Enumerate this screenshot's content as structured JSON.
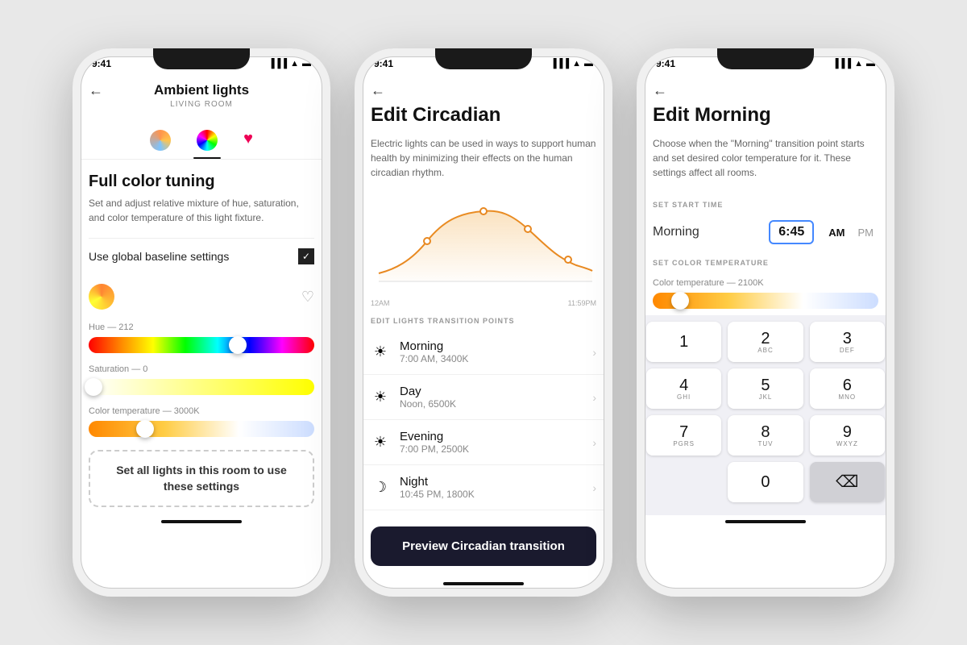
{
  "phone1": {
    "status_time": "9:41",
    "title": "Ambient lights",
    "subtitle": "LIVING ROOM",
    "tabs": [
      {
        "label": "circadian",
        "icon": "circadian"
      },
      {
        "label": "color",
        "icon": "color",
        "active": true
      },
      {
        "label": "favorite",
        "icon": "heart"
      }
    ],
    "section_title": "Full color tuning",
    "section_desc": "Set and adjust relative mixture of hue, saturation, and color temperature of this light fixture.",
    "global_baseline_label": "Use global baseline settings",
    "hue_label": "Hue — 212",
    "hue_thumb_pos": "66%",
    "saturation_label": "Saturation — 0",
    "saturation_thumb_pos": "2%",
    "color_temp_label": "Color temperature — 3000K",
    "color_temp_thumb_pos": "25%",
    "set_all_btn": "Set all lights in this room to use these settings"
  },
  "phone2": {
    "status_time": "9:41",
    "title": "Edit Circadian",
    "description": "Electric lights can be used in ways to support human health by minimizing their effects on the human circadian rhythm.",
    "chart_label_start": "12AM",
    "chart_label_end": "11:59PM",
    "edit_label": "EDIT LIGHTS TRANSITION POINTS",
    "transitions": [
      {
        "icon": "☀",
        "name": "Morning",
        "detail": "7:00 AM, 3400K"
      },
      {
        "icon": "☀",
        "name": "Day",
        "detail": "Noon, 6500K"
      },
      {
        "icon": "☀",
        "name": "Evening",
        "detail": "7:00 PM, 2500K"
      },
      {
        "icon": "☽",
        "name": "Night",
        "detail": "10:45 PM, 1800K"
      }
    ],
    "preview_btn": "Preview Circadian transition"
  },
  "phone3": {
    "status_time": "9:41",
    "title": "Edit Morning",
    "description": "Choose when the \"Morning\" transition point starts and set desired color temperature for it. These settings affect all rooms.",
    "set_start_label": "SET START TIME",
    "time_label": "Morning",
    "time_value": "6:45",
    "am_label": "AM",
    "pm_label": "PM",
    "set_color_label": "SET COLOR TEMPERATURE",
    "color_temp_value": "Color temperature — 2100K",
    "color_temp_thumb_pos": "12%",
    "numpad": {
      "keys": [
        [
          {
            "num": "1",
            "letters": ""
          },
          {
            "num": "2",
            "letters": "ABC"
          },
          {
            "num": "3",
            "letters": "DEF"
          }
        ],
        [
          {
            "num": "4",
            "letters": "GHI"
          },
          {
            "num": "5",
            "letters": "JKL"
          },
          {
            "num": "6",
            "letters": "MNO"
          }
        ],
        [
          {
            "num": "7",
            "letters": "PGRS"
          },
          {
            "num": "8",
            "letters": "TUV"
          },
          {
            "num": "9",
            "letters": "WXYZ"
          }
        ],
        [
          {
            "num": "",
            "letters": "",
            "type": "empty"
          },
          {
            "num": "0",
            "letters": ""
          },
          {
            "num": "⌫",
            "letters": "",
            "type": "delete"
          }
        ]
      ]
    }
  }
}
